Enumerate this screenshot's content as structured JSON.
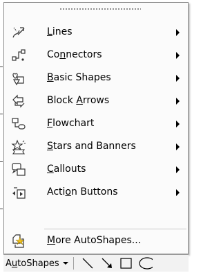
{
  "menu": {
    "items": [
      {
        "pre": "",
        "mnemonic": "L",
        "post": "ines",
        "submenu": true
      },
      {
        "pre": "Co",
        "mnemonic": "n",
        "post": "nectors",
        "submenu": true
      },
      {
        "pre": "",
        "mnemonic": "B",
        "post": "asic Shapes",
        "submenu": true
      },
      {
        "pre": "Block ",
        "mnemonic": "A",
        "post": "rrows",
        "submenu": true
      },
      {
        "pre": "",
        "mnemonic": "F",
        "post": "lowchart",
        "submenu": true
      },
      {
        "pre": "",
        "mnemonic": "S",
        "post": "tars and Banners",
        "submenu": true
      },
      {
        "pre": "",
        "mnemonic": "C",
        "post": "allouts",
        "submenu": true
      },
      {
        "pre": "Acti",
        "mnemonic": "o",
        "post": "n Buttons",
        "submenu": true
      },
      {
        "pre": "",
        "mnemonic": "M",
        "post": "ore AutoShapes...",
        "submenu": false
      }
    ]
  },
  "toolbar": {
    "autoshapes_pre": "A",
    "autoshapes_mnemonic": "u",
    "autoshapes_post": "toShapes"
  },
  "icons": {
    "lines": "lines-icon",
    "connectors": "connectors-icon",
    "basic_shapes": "basic-shapes-icon",
    "block_arrows": "block-arrows-icon",
    "flowchart": "flowchart-icon",
    "stars": "stars-banners-icon",
    "callouts": "callouts-icon",
    "action_buttons": "action-buttons-icon",
    "more": "more-autoshapes-icon"
  },
  "colors": {
    "menu_bg": "#fbfbfb",
    "border": "#8c8c8c",
    "accent_yellow": "#f2c21b",
    "toolbar_bg": "#f2f2f2"
  }
}
